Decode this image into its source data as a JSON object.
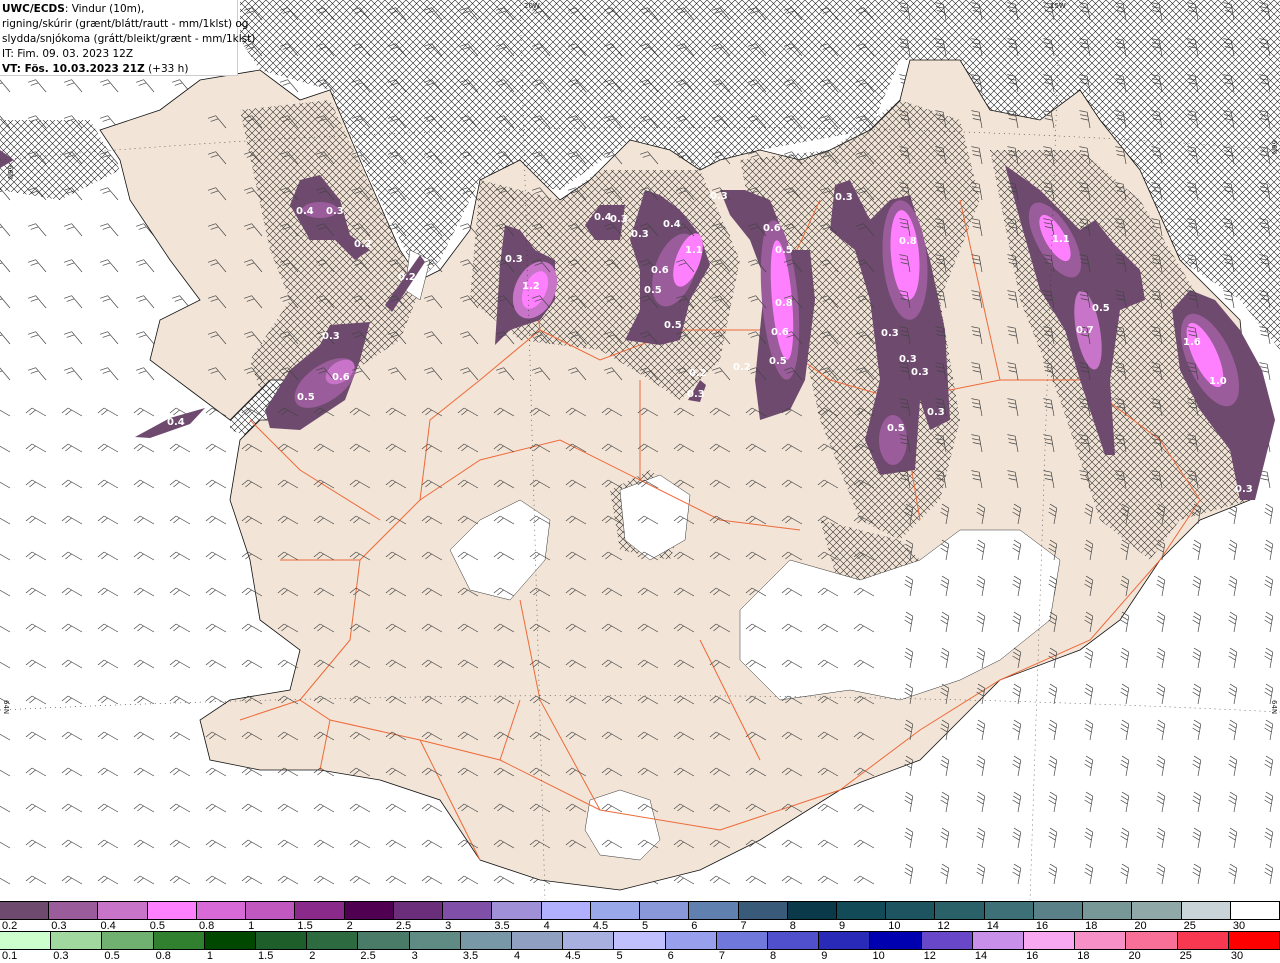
{
  "header": {
    "source": "UWC/ECDS",
    "title_rest": ": Vindur (10m),",
    "line2": "rigning/skúrir (grænt/blátt/rautt - mm/1klst) og",
    "line3": "slydda/snjókoma (grátt/bleikt/grænt - mm/1klst)",
    "it": "IT: Fim. 09. 03. 2023 12Z",
    "vt_bold": "VT: Fös. 10.03.2023 21Z",
    "vt_lead": " (+33 h)"
  },
  "grid_labels": {
    "lon_20w": "20W",
    "lon_15w": "15W",
    "lat_66n_left": "66N",
    "lat_66n_right": "66N",
    "lat_64n_left": "64N",
    "lat_64n_right": "64N"
  },
  "map_colors": {
    "land": "#f2e4d6",
    "sea": "#ffffff",
    "roads": "#ee6a3a",
    "hatch": "#000000",
    "glacier": "#ffffff"
  },
  "precip_labels": [
    "0.4",
    "0.3",
    "0.2",
    "0.2",
    "0.3",
    "0.6",
    "0.5",
    "0.4",
    "0.3",
    "1.2",
    "0.4",
    "0.3",
    "0.3",
    "0.4",
    "1.1",
    "0.6",
    "0.5",
    "0.5",
    "0.2",
    "0.3",
    "0.3",
    "0.6",
    "0.5",
    "0.8",
    "0.6",
    "0.5",
    "0.2",
    "0.3",
    "0.8",
    "0.3",
    "0.3",
    "0.3",
    "0.3",
    "0.5",
    "1.1",
    "0.5",
    "0.7",
    "1.6",
    "1.0",
    "0.3"
  ],
  "legend_snow": {
    "labels": [
      "0.2",
      "0.3",
      "0.4",
      "0.5",
      "0.8",
      "1",
      "1.5",
      "2",
      "2.5",
      "3",
      "3.5",
      "4",
      "4.5",
      "5",
      "6",
      "7",
      "8",
      "9",
      "10",
      "12",
      "14",
      "16",
      "18",
      "20",
      "25",
      "30"
    ],
    "colors": [
      "#6e4a6e",
      "#9a5c9a",
      "#c874c8",
      "#ff80ff",
      "#d86ad8",
      "#c058c0",
      "#8a2a8a",
      "#500050",
      "#6a2e7a",
      "#8050a8",
      "#a090d8",
      "#b0b0ff",
      "#98a8e8",
      "#8898d8",
      "#6080b0",
      "#3a5a7a",
      "#0a3a4a",
      "#124a58",
      "#1e5460",
      "#2a6068",
      "#3e7078",
      "#5a8088",
      "#789898",
      "#90a8a8",
      "#c8d4d8",
      "#ffffff"
    ]
  },
  "legend_rain": {
    "labels": [
      "0.1",
      "0.3",
      "0.5",
      "0.8",
      "1",
      "1.5",
      "2",
      "2.5",
      "3",
      "3.5",
      "4",
      "4.5",
      "5",
      "6",
      "7",
      "8",
      "9",
      "10",
      "12",
      "14",
      "16",
      "18",
      "20",
      "25",
      "30"
    ],
    "colors": [
      "#ccffcc",
      "#a0d8a0",
      "#70b070",
      "#308030",
      "#004800",
      "#1e5e2a",
      "#2e6a40",
      "#4a7a68",
      "#608a84",
      "#7898a8",
      "#90a0c0",
      "#a8b0e0",
      "#c0c0ff",
      "#98a0ee",
      "#7078dc",
      "#5050cc",
      "#2a2ab8",
      "#0000b0",
      "#6848c8",
      "#c890e8",
      "#f8a8f0",
      "#f890c8",
      "#f87098",
      "#f83850",
      "#ff0000"
    ]
  }
}
